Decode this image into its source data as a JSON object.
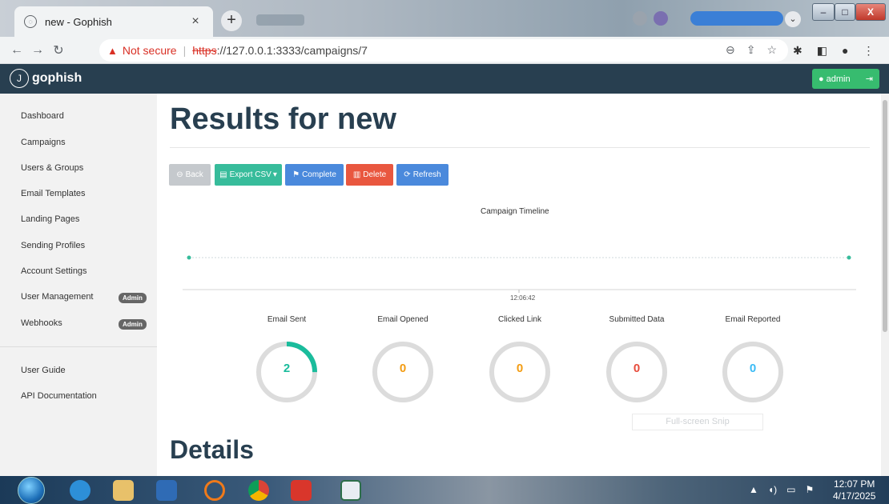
{
  "browser": {
    "tab_title": "new - Gophish",
    "tab_close": "×",
    "new_tab": "+",
    "security_label": "Not secure",
    "url_scheme": "https",
    "url_rest": "://127.0.0.1:3333/campaigns/7"
  },
  "navbar": {
    "brand": "gophish",
    "user_label": "admin"
  },
  "sidebar": {
    "items": [
      {
        "label": "Dashboard"
      },
      {
        "label": "Campaigns"
      },
      {
        "label": "Users & Groups"
      },
      {
        "label": "Email Templates"
      },
      {
        "label": "Landing Pages"
      },
      {
        "label": "Sending Profiles"
      },
      {
        "label": "Account Settings"
      },
      {
        "label": "User Management",
        "badge": "Admin"
      },
      {
        "label": "Webhooks",
        "badge": "Admin"
      }
    ],
    "footer_items": [
      {
        "label": "User Guide"
      },
      {
        "label": "API Documentation"
      }
    ]
  },
  "main": {
    "title": "Results for new",
    "buttons": {
      "back": "Back",
      "export": "Export CSV",
      "complete": "Complete",
      "delete": "Delete",
      "refresh": "Refresh"
    },
    "timeline_title": "Campaign Timeline",
    "timeline_time": "12:06:42",
    "stats": [
      {
        "label": "Email Sent",
        "value": "2",
        "color": "#1abc9c",
        "fraction": 0.25
      },
      {
        "label": "Email Opened",
        "value": "0",
        "color": "#f39c12",
        "fraction": 0
      },
      {
        "label": "Clicked Link",
        "value": "0",
        "color": "#f39c12",
        "fraction": 0
      },
      {
        "label": "Submitted Data",
        "value": "0",
        "color": "#e74c3c",
        "fraction": 0
      },
      {
        "label": "Email Reported",
        "value": "0",
        "color": "#3bbbf5",
        "fraction": 0
      }
    ],
    "snip_overlay": "Full-screen Snip",
    "details_title": "Details"
  },
  "taskbar": {
    "time": "12:07 PM",
    "date": "4/17/2025"
  },
  "colors": {
    "navbar": "#283f50",
    "sidebar": "#f2f2f2",
    "admin_green": "#37bc6f",
    "title": "#283f50"
  }
}
